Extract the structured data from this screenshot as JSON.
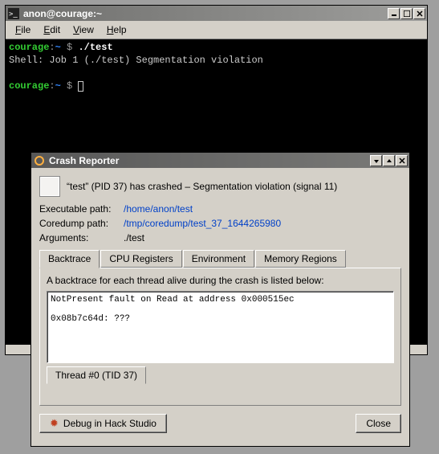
{
  "terminal": {
    "title": "anon@courage:~",
    "menu": {
      "file": "File",
      "edit": "Edit",
      "view": "View",
      "help": "Help"
    },
    "prompt": {
      "host": "courage",
      "path": "~",
      "symbol": "$"
    },
    "command": "./test",
    "output": "Shell: Job 1 (./test) Segmentation violation"
  },
  "crash": {
    "title": "Crash Reporter",
    "header": "“test” (PID 37) has crashed – Segmentation violation (signal 11)",
    "exec_label": "Executable path:",
    "exec_path": "/home/anon/test",
    "core_label": "Coredump path:",
    "core_path": "/tmp/coredump/test_37_1644265980",
    "args_label": "Arguments:",
    "args_val": "./test",
    "tabs": {
      "backtrace": "Backtrace",
      "cpu": "CPU Registers",
      "env": "Environment",
      "mem": "Memory Regions"
    },
    "bt_caption": "A backtrace for each thread alive during the crash is listed below:",
    "bt_line1": "NotPresent fault on Read at address 0x000515ec",
    "bt_line2": "0x08b7c64d: ???",
    "thread_tab": "Thread #0 (TID 37)",
    "debug_btn": "Debug in Hack Studio",
    "close_btn": "Close"
  }
}
